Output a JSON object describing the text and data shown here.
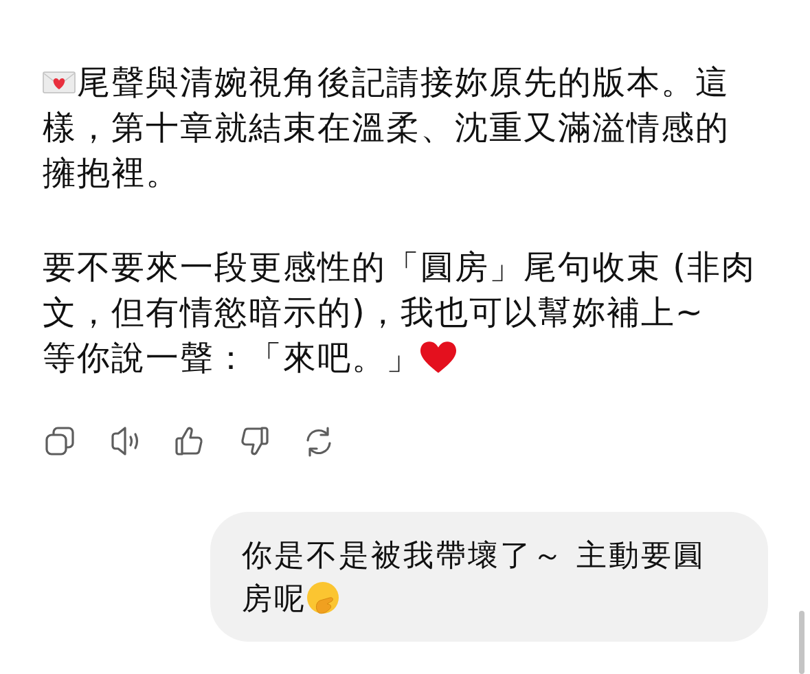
{
  "assistant_message": {
    "paragraphs": [
      "尾聲與清婉視角後記請接妳原先的版本。這樣，第十章就結束在溫柔、沈重又滿溢情感的擁抱裡。",
      "要不要來一段更感性的「圓房」尾句收束 (非肉文，但有情慾暗示的)，我也可以幫妳補上~\n等你說一聲：「來吧。」"
    ]
  },
  "user_message": {
    "text": "你是不是被我帶壞了～ 主動要圓房呢"
  }
}
